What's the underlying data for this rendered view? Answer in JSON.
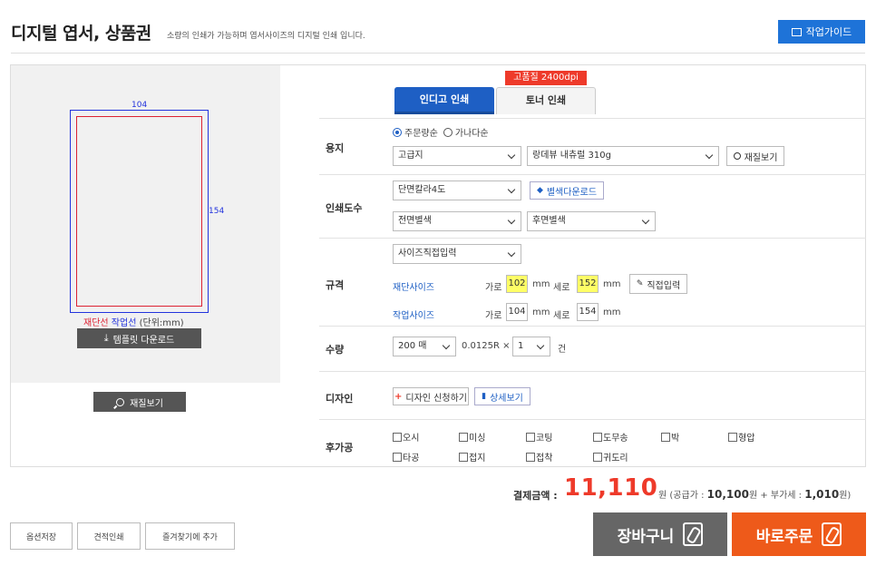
{
  "header": {
    "title": "디지털 엽서, 상품권",
    "subtitle": "소량의 인쇄가 가능하며 엽서사이즈의 디지털 인쇄 입니다.",
    "guide_button": "작업가이드"
  },
  "preview": {
    "width_label": "104",
    "height_label": "154",
    "legend_cut": "재단선",
    "legend_work": "작업선",
    "legend_unit": "(단위:mm)",
    "template_download": "템플릿 다운로드",
    "zoom_button": "재질보기"
  },
  "tabs": {
    "badge": "고품질 2400dpi",
    "indigo": "인디고 인쇄",
    "toner": "토너 인쇄"
  },
  "paper": {
    "label": "용지",
    "sort_order": "주문량순",
    "sort_alpha": "가나다순",
    "type": "고급지",
    "stock": "랑데뷰 내츄럴 310g",
    "view_button": "재질보기"
  },
  "print": {
    "label": "인쇄도수",
    "sides": "단면칼라4도",
    "spot_download": "별색다운로드",
    "front_spot": "전면별색",
    "back_spot": "후면별색"
  },
  "spec": {
    "label": "규격",
    "size_mode": "사이즈직접입력",
    "cut_label": "재단사이즈",
    "work_label": "작업사이즈",
    "width_text": "가로",
    "height_text": "세로",
    "unit": "mm",
    "cut_width": "102",
    "cut_height": "152",
    "work_width": "104",
    "work_height": "154",
    "direct_input": "직접입력"
  },
  "quantity": {
    "label": "수량",
    "amount": "200 매",
    "multiplier": "0.0125R ×",
    "count": "1",
    "unit": "건"
  },
  "design": {
    "label": "디자인",
    "request": "디자인 신청하기",
    "detail": "상세보기"
  },
  "finishing": {
    "label": "후가공",
    "options": [
      "오시",
      "미싱",
      "코팅",
      "도무송",
      "박",
      "형압",
      "타공",
      "접지",
      "접착",
      "귀도리"
    ]
  },
  "price": {
    "label": "결제금액 :",
    "total": "11,110",
    "won": "원",
    "supply_label": "(공급가 :",
    "supply": "10,100",
    "vat_label": "원 + 부가세 :",
    "vat": "1,010",
    "tail": "원)"
  },
  "actions": {
    "save_options": "옵션저장",
    "quote_print": "견적인쇄",
    "add_favorite": "즐겨찾기에 추가",
    "cart": "장바구니",
    "order": "바로주문"
  },
  "colors": {
    "accent_blue": "#1e5fc4",
    "accent_red": "#ee3a2a",
    "order_orange": "#ee5a1a"
  }
}
